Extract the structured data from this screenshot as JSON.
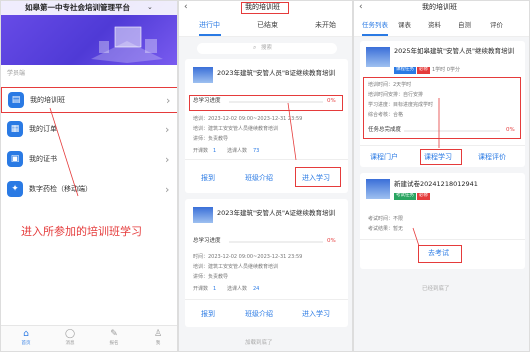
{
  "panel1": {
    "title": "如皋第一中专社会培训管理平台",
    "section_label": "学员端",
    "menu": [
      {
        "label": "我的培训班",
        "icon": "book-icon",
        "color": "#2a7ae4"
      },
      {
        "label": "我的订单",
        "icon": "order-icon",
        "color": "#2a7ae4"
      },
      {
        "label": "我的证书",
        "icon": "certificate-icon",
        "color": "#2a7ae4"
      },
      {
        "label": "数字药检（移动端）",
        "icon": "compass-icon",
        "color": "#2a7ae4"
      }
    ],
    "annotation": "进入所参加的培训班学习",
    "tabbar": [
      {
        "label": "首页",
        "icon": "home-icon"
      },
      {
        "label": "消息",
        "icon": "chat-icon"
      },
      {
        "label": "报名",
        "icon": "edit-icon"
      },
      {
        "label": "我",
        "icon": "user-icon"
      }
    ]
  },
  "panel2": {
    "title": "我的培训班",
    "tabs": [
      "进行中",
      "已结束",
      "未开始"
    ],
    "search_placeholder": "搜索",
    "courses": [
      {
        "title": "2023年建筑\"安管人员\"B证继续教育培训",
        "progress_label": "总学习进度",
        "progress_value": "0%",
        "progress_fraction": 0,
        "date_line": "培训：2023-12-02 09:00~2023-12-31 23:59",
        "org_line": "培训：建筑工安安管人员继续教育培训",
        "teacher_line": "讲师：负责教导",
        "counts": {
          "l1": "开课数",
          "v1": "1",
          "l2": "选课人数",
          "v2": "73"
        },
        "actions": [
          "报到",
          "班级介绍",
          "进入学习"
        ]
      },
      {
        "title": "2023年建筑\"安管人员\"A证继续教育培训",
        "progress_label": "总学习进度",
        "progress_value": "0%",
        "progress_fraction": 0,
        "date_line": "时间：2023-12-02 09:00~2023-12-31 23:59",
        "org_line": "培训：建筑工安安管人员继续教育培训",
        "teacher_line": "讲师：负责教导",
        "counts": {
          "l1": "开课数",
          "v1": "1",
          "l2": "选课人数",
          "v2": "24"
        },
        "actions": [
          "报到",
          "班级介绍",
          "进入学习"
        ]
      }
    ],
    "bottom_note": "加载到底了"
  },
  "panel3": {
    "title": "我的培训班",
    "tabs": [
      "任务列表",
      "课表",
      "资料",
      "自测",
      "评价"
    ],
    "course": {
      "title": "2025年如皋建筑\"安管人员\"继续教育培训",
      "badges": [
        {
          "label": "课程任务",
          "color": "#2a7ae4"
        },
        {
          "label": "必修",
          "color": "#e53b3b"
        }
      ],
      "meta": "1学时  0学分",
      "lines": [
        "培训时间：2天学时",
        "培训时间安排：自行安排",
        "学习进度：目标进度完成学时",
        "综合考核：合格"
      ],
      "progress_label": "任务总完成度",
      "progress_value": "0%",
      "progress_fraction": 0,
      "actions": [
        "课程门户",
        "课程学习",
        "课程评价"
      ]
    },
    "exam": {
      "title": "新建试卷20241218012941",
      "badges": [
        {
          "label": "考试任务",
          "color": "#2aa561"
        },
        {
          "label": "必修",
          "color": "#e53b3b"
        }
      ],
      "lines": [
        "考试时间：不限",
        "考试结果：暂无"
      ],
      "action": "去考试"
    },
    "bottom_note": "已经到底了"
  }
}
